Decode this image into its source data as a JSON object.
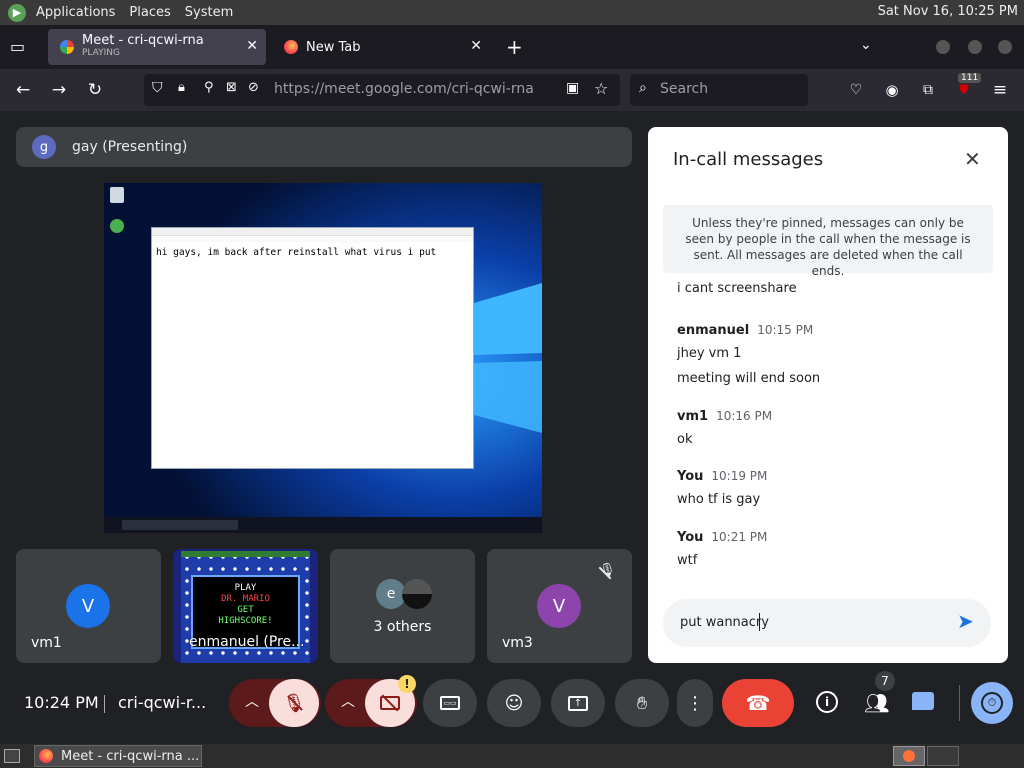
{
  "panel": {
    "menus": [
      "Applications",
      "Places",
      "System"
    ],
    "clock": "Sat Nov 16, 10:25 PM"
  },
  "tabs": [
    {
      "title": "Meet - cri-qcwi-rna",
      "subtitle": "PLAYING",
      "icon": "google-meet-icon",
      "active": true
    },
    {
      "title": "New Tab",
      "icon": "firefox-icon",
      "active": false
    }
  ],
  "nav": {
    "url_host": "https://meet.google.com/",
    "url_path": "cri-qcwi-rna",
    "search_placeholder": "Search",
    "extension_badge": "111"
  },
  "presenting": {
    "initial": "g",
    "label": "gay (Presenting)",
    "notepad_text": "hi gays, im back after reinstall what virus i put"
  },
  "tiles": [
    {
      "initial": "V",
      "name": "vm1",
      "color": "#1a73e8"
    },
    {
      "name": "enmanuel (Pre...",
      "game_lines": [
        "PLAY",
        "DR. MARIO",
        "GET",
        "HIGHSCORE!"
      ]
    },
    {
      "initial": "e",
      "name": "3 others"
    },
    {
      "initial": "V",
      "name": "vm3",
      "color": "#8e44ad",
      "muted": true
    }
  ],
  "chat": {
    "title": "In-call messages",
    "notice": "Unless they're pinned, messages can only be seen by people in the call when the message is sent. All messages are deleted when the call ends.",
    "partial_message": "i cant screenshare",
    "messages": [
      {
        "sender": "enmanuel",
        "time": "10:15 PM",
        "lines": [
          "jhey vm 1",
          "meeting will end soon"
        ]
      },
      {
        "sender": "vm1",
        "time": "10:16 PM",
        "lines": [
          "ok"
        ]
      },
      {
        "sender": "You",
        "time": "10:19 PM",
        "lines": [
          "who tf is gay"
        ]
      },
      {
        "sender": "You",
        "time": "10:21 PM",
        "lines": [
          "wtf"
        ]
      }
    ],
    "input_value": "put wannacry"
  },
  "bottom": {
    "time": "10:24 PM",
    "meeting_code": "cri-qcwi-r...",
    "people_count": "7",
    "warning": "!"
  },
  "taskbar": {
    "window_title": "Meet - cri-qcwi-rna ..."
  },
  "colors": {
    "accent": "#1a73e8",
    "danger": "#ea4335",
    "mute_bg": "#f9dedc",
    "meet_bg": "#202124",
    "surface": "#3c4043"
  }
}
